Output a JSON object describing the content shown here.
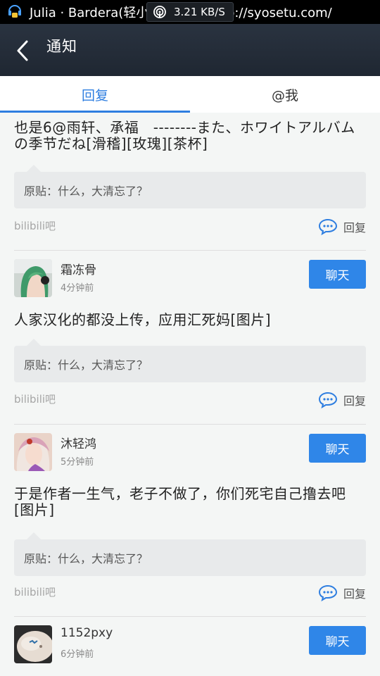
{
  "status_bar": {
    "notification_text": "Julia · Bardera(轻小说同好会):http://syosetu.com/"
  },
  "net_speed": "3.21 KB/S",
  "header": {
    "title": "通知"
  },
  "tabs": [
    {
      "label": "回复",
      "active": true
    },
    {
      "label": "@我",
      "active": false
    }
  ],
  "colors": {
    "accent": "#2e7ee0",
    "chat_button": "#2f86e8"
  },
  "items": [
    {
      "content": "也是6@雨轩、承福　--------また、ホワイトアルバムの季节だね[滑稽][玫瑰][茶杯]",
      "quote": "原贴：什么，大清忘了？",
      "forum": "bilibili吧",
      "reply_label": "回复"
    },
    {
      "user": {
        "name": "霜冻骨",
        "time": "4分钟前",
        "chat_label": "聊天"
      },
      "content": "人家汉化的都没上传，应用汇死妈[图片]",
      "quote": "原贴：什么，大清忘了？",
      "forum": "bilibili吧",
      "reply_label": "回复"
    },
    {
      "user": {
        "name": "沐轻鸿",
        "time": "5分钟前",
        "chat_label": "聊天"
      },
      "content": " 于是作者一生气，老子不做了，你们死宅自己撸去吧[图片]",
      "quote": "原贴：什么，大清忘了？",
      "forum": "bilibili吧",
      "reply_label": "回复"
    },
    {
      "user": {
        "name": "1152pxy",
        "time": "6分钟前",
        "chat_label": "聊天"
      }
    }
  ]
}
